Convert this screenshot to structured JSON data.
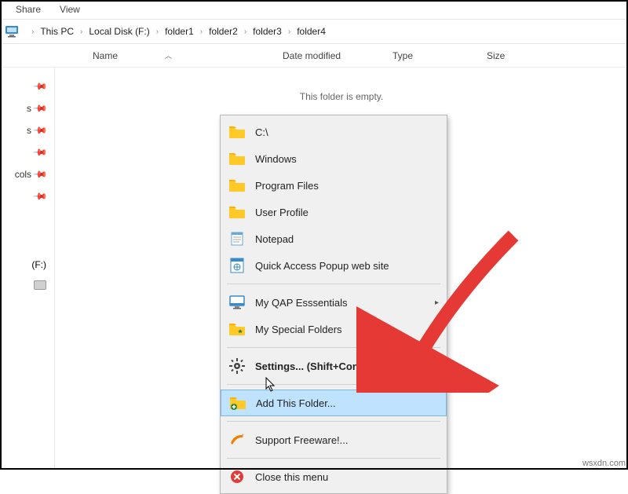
{
  "ribbon": {
    "share": "Share",
    "view": "View"
  },
  "breadcrumb": {
    "items": [
      "This PC",
      "Local Disk (F:)",
      "folder1",
      "folder2",
      "folder3",
      "folder4"
    ]
  },
  "columns": {
    "name": "Name",
    "date": "Date modified",
    "type": "Type",
    "size": "Size"
  },
  "sidebar": {
    "quick": [
      "",
      "s",
      "s",
      "",
      "cols"
    ],
    "drive": "(F:)"
  },
  "pane": {
    "empty": "This folder is empty."
  },
  "menu": {
    "c": "C:\\",
    "windows": "Windows",
    "programfiles": "Program Files",
    "userprofile": "User Profile",
    "notepad": "Notepad",
    "qapsite": "Quick Access Popup web site",
    "essentials": "My QAP Esssentials",
    "special": "My Special Folders",
    "settings": "Settings... (Shift+Control+S)",
    "addthis": "Add This Folder...",
    "support": "Support Freeware!...",
    "close": "Close this menu"
  },
  "watermark": "wsxdn.com"
}
